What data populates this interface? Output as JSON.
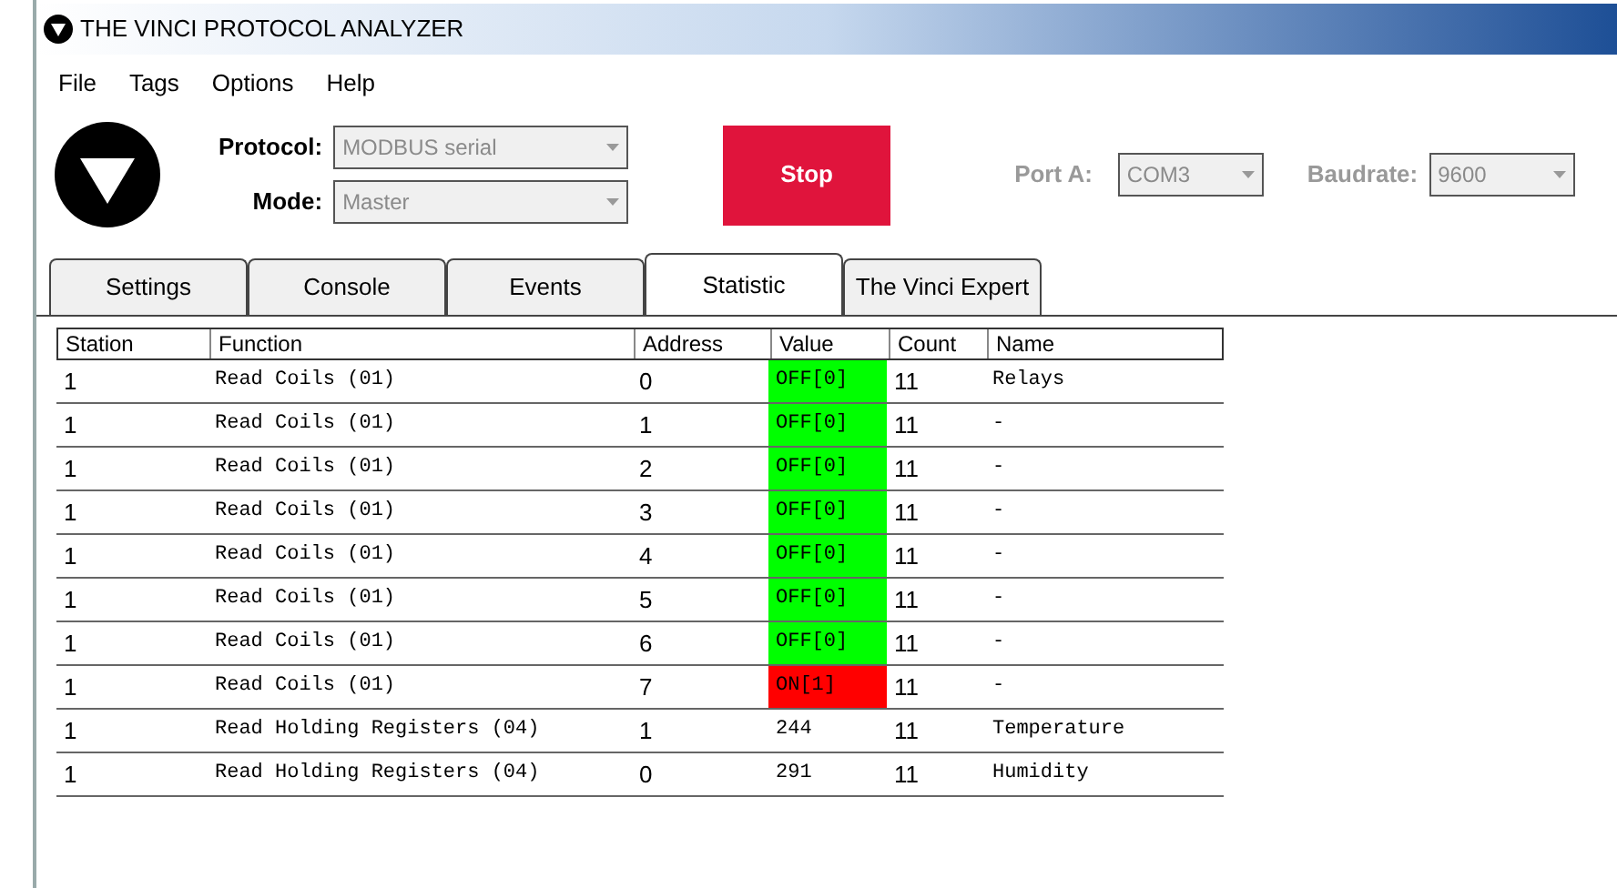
{
  "window": {
    "title": "THE VINCI PROTOCOL ANALYZER"
  },
  "menu": [
    "File",
    "Tags",
    "Options",
    "Help"
  ],
  "protocol": {
    "label": "Protocol:",
    "value": "MODBUS serial",
    "disabled": true
  },
  "mode": {
    "label": "Mode:",
    "value": "Master",
    "disabled": true
  },
  "stop_button": "Stop",
  "port": {
    "label": "Port A:",
    "value": "COM3",
    "disabled": true
  },
  "baudrate": {
    "label": "Baudrate:",
    "value": "9600",
    "disabled": true
  },
  "tabs": [
    {
      "label": "Settings",
      "selected": false
    },
    {
      "label": "Console",
      "selected": false
    },
    {
      "label": "Events",
      "selected": false
    },
    {
      "label": "Statistic",
      "selected": true
    },
    {
      "label": "The Vinci Expert",
      "selected": false
    }
  ],
  "table": {
    "columns": [
      "Station",
      "Function",
      "Address",
      "Value",
      "Count",
      "Name"
    ],
    "rows": [
      {
        "station": "1",
        "function": "Read Coils (01)",
        "address": "0",
        "value": "OFF[0]",
        "color": "#00ff00",
        "count": "11",
        "name": "Relays"
      },
      {
        "station": "1",
        "function": "Read Coils (01)",
        "address": "1",
        "value": "OFF[0]",
        "color": "#00ff00",
        "count": "11",
        "name": "-"
      },
      {
        "station": "1",
        "function": "Read Coils (01)",
        "address": "2",
        "value": "OFF[0]",
        "color": "#00ff00",
        "count": "11",
        "name": "-"
      },
      {
        "station": "1",
        "function": "Read Coils (01)",
        "address": "3",
        "value": "OFF[0]",
        "color": "#00ff00",
        "count": "11",
        "name": "-"
      },
      {
        "station": "1",
        "function": "Read Coils (01)",
        "address": "4",
        "value": "OFF[0]",
        "color": "#00ff00",
        "count": "11",
        "name": "-"
      },
      {
        "station": "1",
        "function": "Read Coils (01)",
        "address": "5",
        "value": "OFF[0]",
        "color": "#00ff00",
        "count": "11",
        "name": "-"
      },
      {
        "station": "1",
        "function": "Read Coils (01)",
        "address": "6",
        "value": "OFF[0]",
        "color": "#00ff00",
        "count": "11",
        "name": "-"
      },
      {
        "station": "1",
        "function": "Read Coils (01)",
        "address": "7",
        "value": "ON[1]",
        "color": "#ff0000",
        "count": "11",
        "name": "-"
      },
      {
        "station": "1",
        "function": "Read Holding Registers (04)",
        "address": "1",
        "value": "244",
        "count": "11",
        "name": "Temperature"
      },
      {
        "station": "1",
        "function": "Read Holding Registers (04)",
        "address": "0",
        "value": "291",
        "count": "11",
        "name": "Humidity"
      }
    ]
  }
}
